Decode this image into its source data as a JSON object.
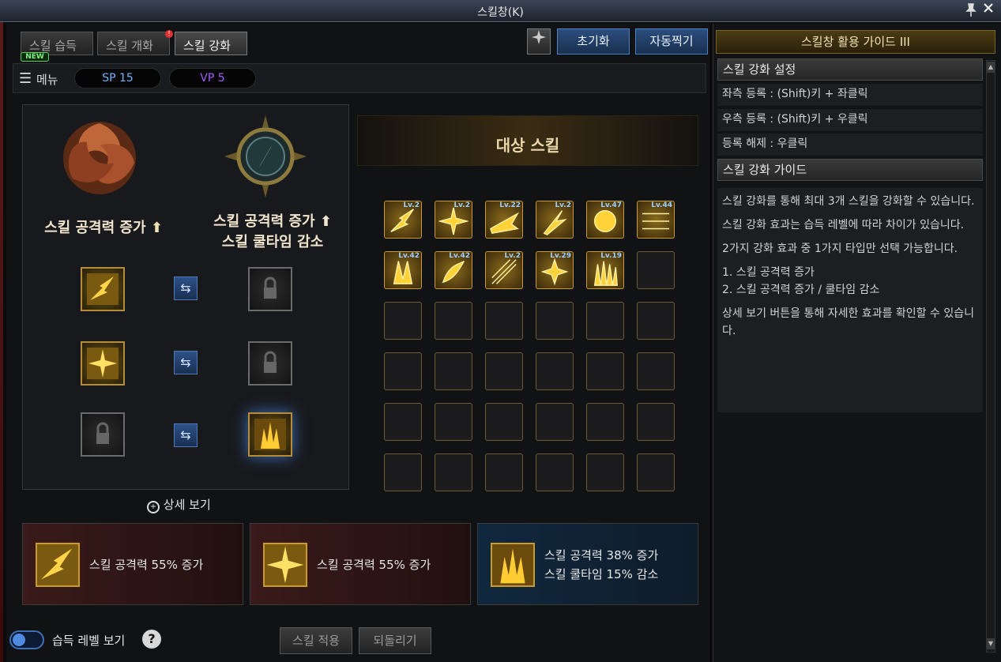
{
  "window": {
    "title": "스킬창(K)"
  },
  "tabs": [
    {
      "label": "스킬 습득"
    },
    {
      "label": "스킬 개화"
    },
    {
      "label": "스킬 강화"
    }
  ],
  "badges": {
    "new": "NEW",
    "alert": "!"
  },
  "toolbar": {
    "reset_label": "초기화",
    "auto_label": "자동찍기"
  },
  "menu": {
    "label": "메뉴",
    "sp": "SP 15",
    "vp": "VP 5"
  },
  "upgrade": {
    "option1_title": "스킬 공격력 증가",
    "option2_line1": "스킬 공격력 증가",
    "option2_line2": "스킬 쿨타임 감소",
    "detail_label": "상세 보기"
  },
  "target": {
    "title": "대상 스킬",
    "levels": [
      "Lv.2",
      "Lv.2",
      "Lv.22",
      "Lv.2",
      "Lv.47",
      "Lv.44",
      "Lv.42",
      "Lv.42",
      "Lv.2",
      "Lv.29",
      "Lv.19"
    ]
  },
  "effects": [
    {
      "line1": "스킬 공격력 55% 증가",
      "line2": ""
    },
    {
      "line1": "스킬 공격력 55% 증가",
      "line2": ""
    },
    {
      "line1": "스킬 공격력 38% 증가",
      "line2": "스킬 쿨타임 15% 감소"
    }
  ],
  "bottom": {
    "toggle_label": "습득 레벨 보기",
    "help": "?",
    "apply_label": "스킬 적용",
    "revert_label": "되돌리기"
  },
  "guide": {
    "header": "스킬창 활용 가이드 III",
    "section1": "스킬 강화 설정",
    "rows": [
      "좌측 등록 : (Shift)키 + 좌클릭",
      "우측 등록 : (Shift)키 + 우클릭",
      "등록 해제 : 우클릭"
    ],
    "section2": "스킬 강화 가이드",
    "body": [
      "스킬 강화를 통해 최대 3개 스킬을 강화할 수 있습니다.",
      "스킬 강화 효과는 습득 레벨에 따라 차이가 있습니다.",
      "2가지 강화 효과 중 1가지 타입만 선택 가능합니다.",
      "1. 스킬 공격력 증가\n2. 스킬 공격력 증가 / 쿨타임 감소",
      "상세 보기 버튼을 통해 자세한 효과를 확인할 수 있습니다."
    ]
  },
  "colors": {
    "accent_blue": "#2c4d7e",
    "gold": "#c99a2e",
    "vp_purple": "#a25cff",
    "sp_blue": "#6fb2ff"
  }
}
